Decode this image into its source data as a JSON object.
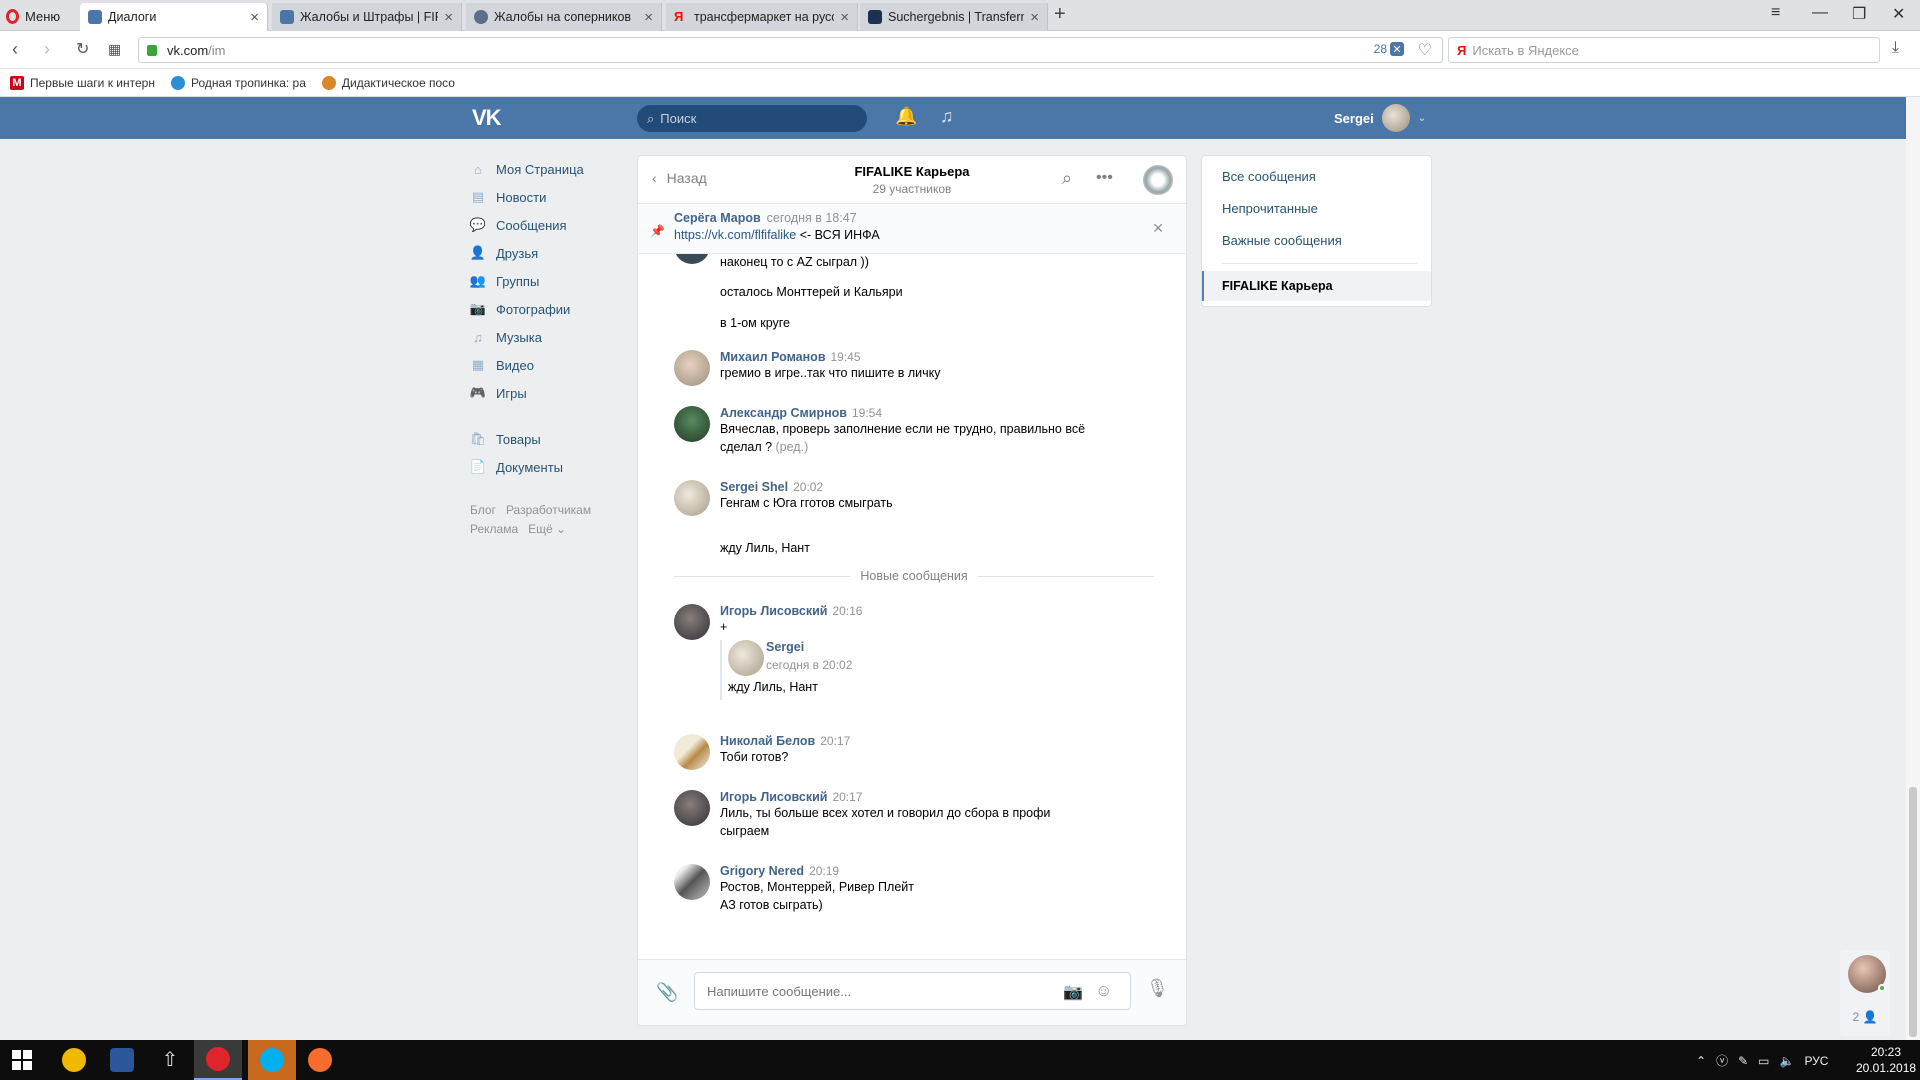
{
  "browser": {
    "menu_label": "Меню",
    "tabs": [
      {
        "title": "Диалоги",
        "color": "#4a76a8"
      },
      {
        "title": "Жалобы и Штрафы | FIFALIKE",
        "color": "#4a76a8"
      },
      {
        "title": "Жалобы на соперников",
        "color": "#5a6f8a"
      },
      {
        "title": "трансфермаркет на русском",
        "color": "#e61400"
      },
      {
        "title": "Suchergebnis | Transfermarkt",
        "color": "#1a3151"
      }
    ],
    "url_host": "vk.com",
    "url_path": "/im",
    "adblock_count": "28",
    "yandex_placeholder": "Искать в Яндексе",
    "bookmarks": [
      {
        "title": "Первые шаги к интернету",
        "color": "#d0021b"
      },
      {
        "title": "Родная тропинка: ра",
        "color": "#2b8fd6"
      },
      {
        "title": "Дидактическое посо",
        "color": "#d8872b"
      }
    ]
  },
  "vk": {
    "search_placeholder": "Поиск",
    "user_name": "Sergei",
    "menu": [
      {
        "label": "Моя Страница",
        "icon": "home-icon",
        "glyph": "⌂"
      },
      {
        "label": "Новости",
        "icon": "news-icon",
        "glyph": "▤"
      },
      {
        "label": "Сообщения",
        "icon": "messages-icon",
        "glyph": "💬"
      },
      {
        "label": "Друзья",
        "icon": "friends-icon",
        "glyph": "👤"
      },
      {
        "label": "Группы",
        "icon": "groups-icon",
        "glyph": "👥"
      },
      {
        "label": "Фотографии",
        "icon": "camera-icon",
        "glyph": "📷"
      },
      {
        "label": "Музыка",
        "icon": "music-icon",
        "glyph": "♫"
      },
      {
        "label": "Видео",
        "icon": "video-icon",
        "glyph": "▦"
      },
      {
        "label": "Игры",
        "icon": "games-icon",
        "glyph": "🎮"
      }
    ],
    "menu2": [
      {
        "label": "Товары",
        "icon": "goods-icon",
        "glyph": "🛍"
      },
      {
        "label": "Документы",
        "icon": "documents-icon",
        "glyph": "📄"
      }
    ],
    "footer": {
      "blog": "Блог",
      "dev": "Разработчикам",
      "ads": "Реклама",
      "more": "Ещё ⌄"
    }
  },
  "chat": {
    "back_label": "Назад",
    "title": "FIFALIKE Карьера",
    "subtitle": "29 участников",
    "pinned": {
      "author": "Серёга Маров",
      "time": "сегодня в 18:47",
      "link": "https://vk.com/flfifalike",
      "text": " <- ВСЯ ИНФА"
    },
    "cont_lines": [
      "наконец то с AZ сыграл ))",
      "осталось Монттерей и Кальяри",
      "в 1-ом круге"
    ],
    "messages": [
      {
        "author": "Михаил Романов",
        "time": "19:45",
        "lines": [
          "гремио в игре..так что пишите в личку"
        ],
        "avatar": "#9a8f7c"
      },
      {
        "author": "Александр Смирнов",
        "time": "19:54",
        "lines": [
          "Вячеслав, проверь заполнение если не трудно, правильно всё",
          "сделал ?"
        ],
        "edited": " (ред.)",
        "avatar": "#2f5a3a"
      },
      {
        "author": "Sergei Shel",
        "time": "20:02",
        "lines": [
          "Генгам с Юга гготов смыграть"
        ],
        "extra": "жду Лиль, Нант",
        "avatar": "#cfc6b4"
      }
    ],
    "new_messages_label": "Новые сообщения",
    "messages_new": [
      {
        "author": "Игорь Лисовский",
        "time": "20:16",
        "lines": [
          "+"
        ],
        "avatar": "#4a4a55"
      },
      {
        "author": "Николай Белов",
        "time": "20:17",
        "lines": [
          "Тоби готов?"
        ],
        "avatar": "#c8b58e"
      },
      {
        "author": "Игорь Лисовский",
        "time": "20:17",
        "lines": [
          "Лиль, ты больше всех хотел и говорил до сбора в профи",
          "сыграем"
        ],
        "avatar": "#4a4a55"
      },
      {
        "author": "Grigory Nered",
        "time": "20:19",
        "lines": [
          "Ростов, Монтеррей, Ривер Плейт",
          "АЗ готов сыграть)"
        ],
        "avatar": "#777"
      }
    ],
    "quote": {
      "name": "Sergei",
      "time": "сегодня в 20:02",
      "text": "жду Лиль, Нант"
    },
    "composer_placeholder": "Напишите сообщение..."
  },
  "rightpanel": {
    "items": [
      "Все сообщения",
      "Непрочитанные",
      "Важные сообщения"
    ],
    "active": "FIFALIKE Карьера"
  },
  "widget": {
    "count": "2 👤"
  },
  "taskbar": {
    "lang": "РУС",
    "time": "20:23",
    "date": "20.01.2018"
  }
}
